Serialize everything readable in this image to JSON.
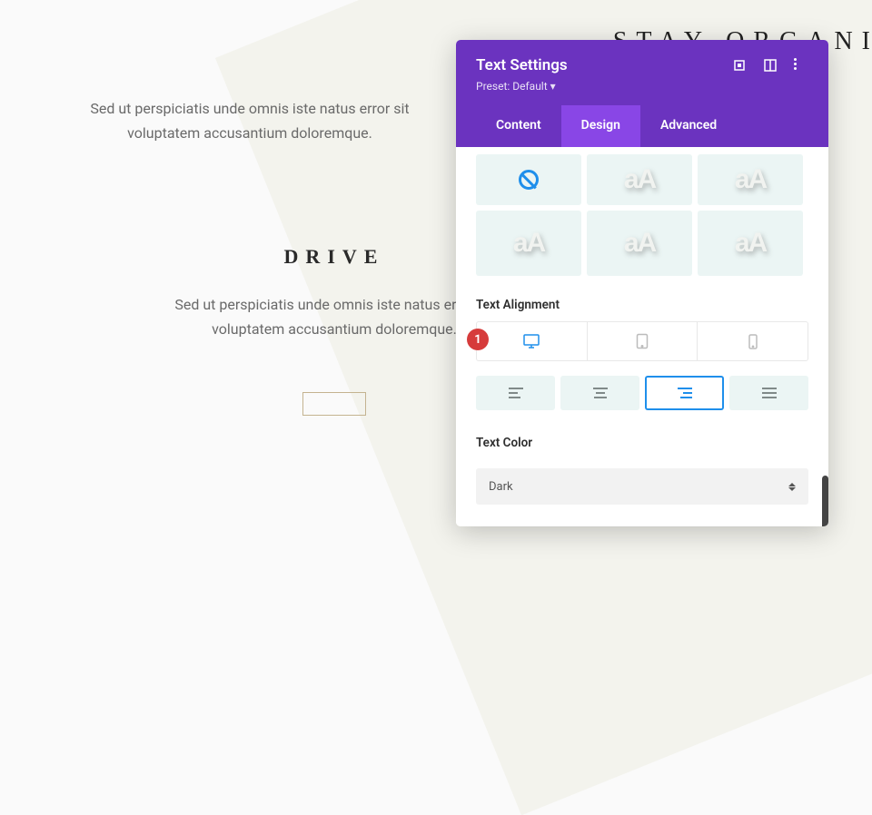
{
  "page": {
    "heading_partial": "STAY ORGANI",
    "para1": "Sed ut perspiciatis unde omnis iste natus error sit voluptatem accusantium doloremque.",
    "section2_heading": "DRIVE",
    "para2": "Sed ut perspiciatis unde omnis iste natus error sit voluptatem accusantium doloremque.",
    "button_label": " "
  },
  "panel": {
    "title": "Text Settings",
    "preset_label": "Preset: Default ▾",
    "tabs": {
      "content": "Content",
      "design": "Design",
      "advanced": "Advanced"
    },
    "text_alignment_label": "Text Alignment",
    "text_color_label": "Text Color",
    "text_color_value": "Dark",
    "badge": "1",
    "style_text": "aA"
  }
}
